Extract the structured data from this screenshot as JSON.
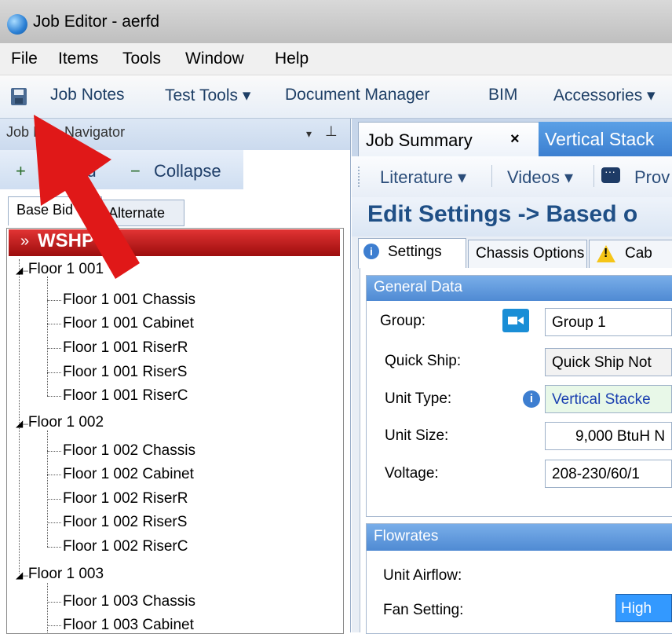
{
  "window": {
    "title": "Job Editor - aerfd"
  },
  "menu": [
    "File",
    "Items",
    "Tools",
    "Window",
    "Help"
  ],
  "toolbar": {
    "items": [
      "Job Notes",
      "Test Tools ▾",
      "Document Manager",
      "BIM",
      "Accessories ▾"
    ]
  },
  "navigator": {
    "title": "Job Item Navigator",
    "dropdown": "▾",
    "pin": "⊥",
    "expand_plus": "+",
    "expand_label": "Expand",
    "collapse_minus": "−",
    "collapse_label": "Collapse",
    "tabs": [
      "Base Bid",
      "Alternate"
    ],
    "root": {
      "chevron": "»",
      "label": "WSHP"
    },
    "floors": [
      {
        "label": "Floor 1 001",
        "children": [
          "Floor 1 001 Chassis",
          "Floor 1 001 Cabinet",
          "Floor 1 001 RiserR",
          "Floor 1 001 RiserS",
          "Floor 1 001 RiserC"
        ]
      },
      {
        "label": "Floor 1 002",
        "children": [
          "Floor 1 002 Chassis",
          "Floor 1 002 Cabinet",
          "Floor 1 002 RiserR",
          "Floor 1 002 RiserS",
          "Floor 1 002 RiserC"
        ]
      },
      {
        "label": "Floor 1 003",
        "children": [
          "Floor 1 003 Chassis",
          "Floor 1 003 Cabinet"
        ]
      }
    ]
  },
  "doc_tabs": {
    "job_summary": "Job Summary",
    "close": "×",
    "vertical_stack": "Vertical Stack"
  },
  "sub_toolbar": {
    "literature": "Literature ▾",
    "videos": "Videos ▾",
    "prov": "Prov"
  },
  "edit": {
    "title": "Edit Settings -> Based o",
    "tabs": {
      "settings": "Settings",
      "chassis": "Chassis Options",
      "cab": "Cab"
    }
  },
  "general_data": {
    "title": "General Data",
    "group_label": "Group:",
    "group_value": "Group 1",
    "quickship_label": "Quick Ship:",
    "quickship_value": "Quick Ship Not",
    "unittype_label": "Unit Type:",
    "unittype_value": "Vertical Stacke",
    "unitsize_label": "Unit Size:",
    "unitsize_value": "9,000 BtuH N",
    "voltage_label": "Voltage:",
    "voltage_value": "208-230/60/1"
  },
  "flowrates": {
    "title": "Flowrates",
    "airflow_label": "Unit Airflow:",
    "fan_label": "Fan Setting:",
    "fan_value": "High"
  },
  "colors": {
    "accent_red": "#e01818",
    "tab_blue": "#3c7fd0",
    "header_blue": "#1f4f86"
  },
  "icons": [
    "globe-icon",
    "save-icon",
    "video-icon",
    "info-icon",
    "warning-icon",
    "chat-icon",
    "red-arrow-annotation"
  ]
}
